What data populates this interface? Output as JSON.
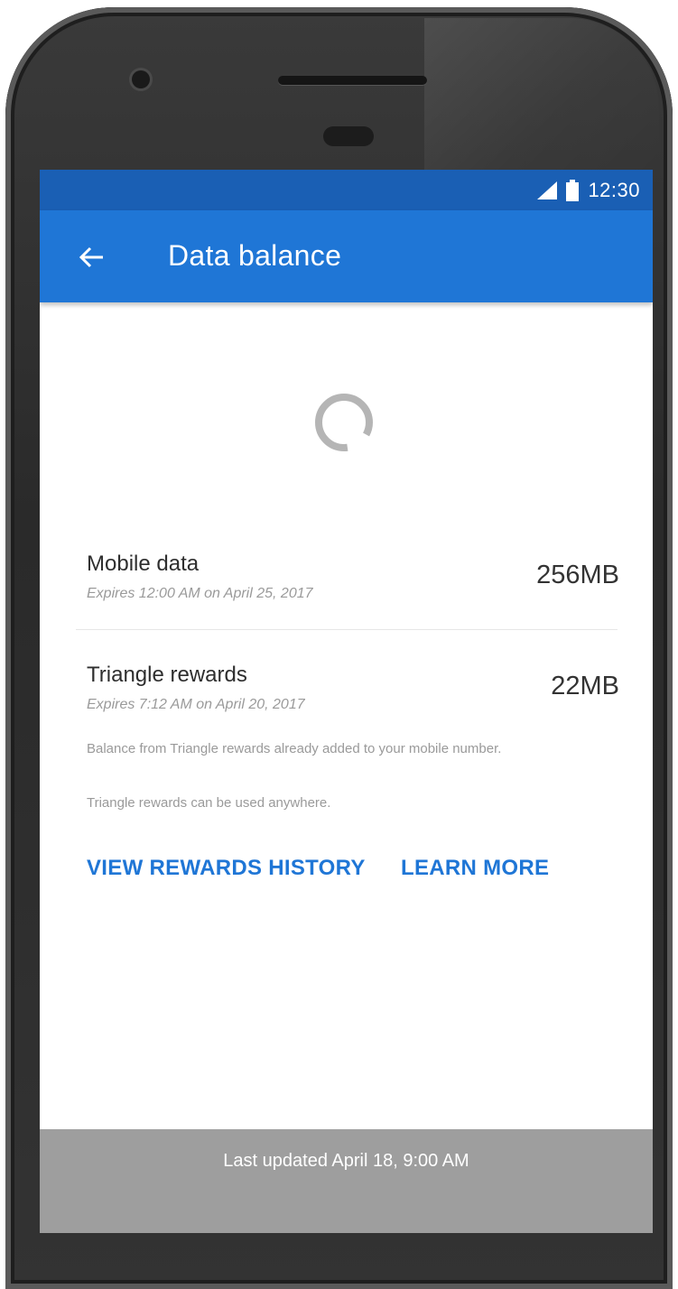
{
  "status_bar": {
    "time": "12:30"
  },
  "app_bar": {
    "title": "Data balance"
  },
  "balances": [
    {
      "title": "Mobile data",
      "expiry": "Expires 12:00 AM on April 25, 2017",
      "amount": "256MB"
    },
    {
      "title": "Triangle rewards",
      "expiry": "Expires 7:12 AM on April 20, 2017",
      "amount": "22MB"
    }
  ],
  "notes": [
    "Balance from Triangle rewards already added to your mobile number.",
    "Triangle rewards can be used anywhere."
  ],
  "actions": {
    "view_rewards_history": "VIEW REWARDS HISTORY",
    "learn_more": "LEARN MORE"
  },
  "footer": {
    "last_updated": "Last updated April 18, 9:00 AM"
  },
  "colors": {
    "accent": "#1f76d6",
    "status_bar": "#1a5fb4",
    "footer": "#9e9e9e"
  },
  "icons": {
    "back": "arrow-back-icon",
    "signal": "signal-icon",
    "battery": "battery-icon",
    "loading": "loading-spinner-icon"
  }
}
